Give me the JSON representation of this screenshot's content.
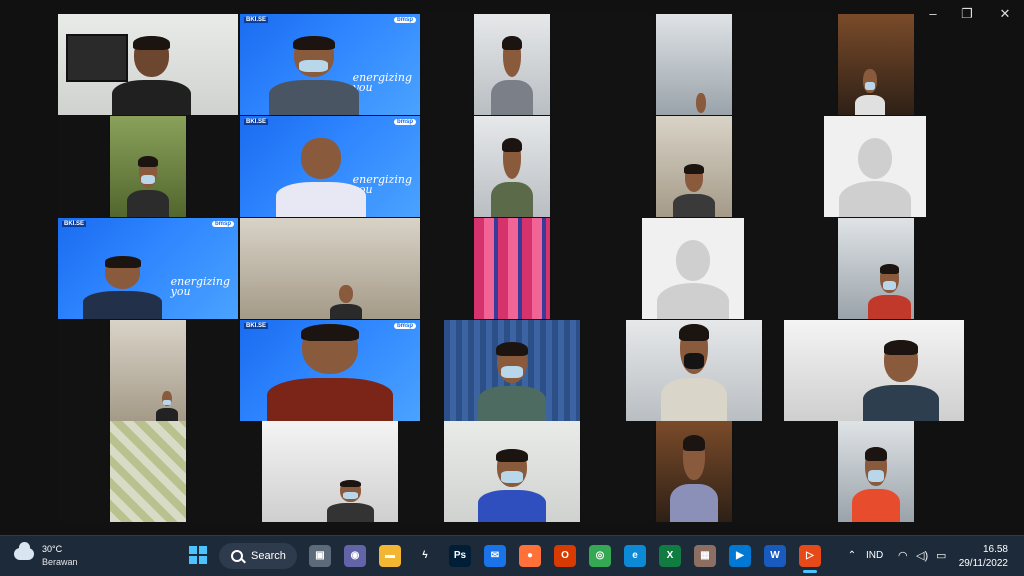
{
  "window_controls": {
    "minimize": "–",
    "maximize": "❐",
    "close": "✕"
  },
  "meeting": {
    "brand_left": "BKI.SE",
    "brand_right": "bmsp",
    "slogan_line1": "energizing",
    "slogan_line2": "you"
  },
  "taskbar": {
    "weather_temp": "30°C",
    "weather_desc": "Berawan",
    "search_label": "Search",
    "tray_language": "IND",
    "time": "16.58",
    "date": "29/11/2022",
    "apps": [
      {
        "name": "task-view-icon",
        "glyph": "▣",
        "color": "#5c6b7a"
      },
      {
        "name": "meet-video-icon",
        "glyph": "◉",
        "color": "#6264a7"
      },
      {
        "name": "file-explorer-icon",
        "glyph": "▬",
        "color": "#f2b632"
      },
      {
        "name": "lightning-app-icon",
        "glyph": "ϟ",
        "color": "#1d2a3a"
      },
      {
        "name": "photoshop-icon",
        "glyph": "Ps",
        "color": "#001e36"
      },
      {
        "name": "mail-icon",
        "glyph": "✉",
        "color": "#1a73e8"
      },
      {
        "name": "firefox-icon",
        "glyph": "●",
        "color": "#ff7139"
      },
      {
        "name": "office-icon",
        "glyph": "O",
        "color": "#d83b01"
      },
      {
        "name": "chrome-icon",
        "glyph": "◎",
        "color": "#34a853"
      },
      {
        "name": "edge-icon",
        "glyph": "e",
        "color": "#0c8ad6"
      },
      {
        "name": "excel-icon",
        "glyph": "X",
        "color": "#107c41"
      },
      {
        "name": "photo-viewer-icon",
        "glyph": "▦",
        "color": "#8d6e63"
      },
      {
        "name": "movies-icon",
        "glyph": "▶",
        "color": "#0078d4"
      },
      {
        "name": "word-icon",
        "glyph": "W",
        "color": "#185abd"
      },
      {
        "name": "media-player-icon",
        "glyph": "▷",
        "color": "#e64a19"
      }
    ]
  }
}
